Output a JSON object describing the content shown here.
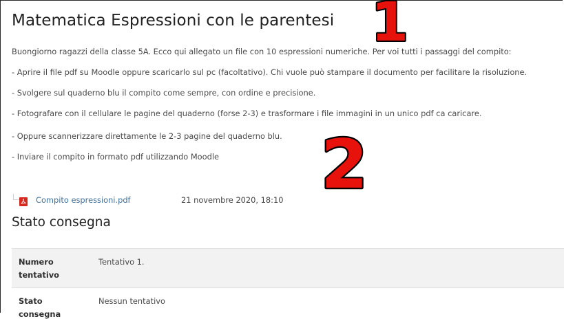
{
  "page": {
    "title": "Matematica Espressioni con le parentesi",
    "intro": "Buongiorno ragazzi della classe 5A. Ecco qui allegato un file con 10 espressioni numeriche. Per voi tutti i passaggi del compito:",
    "steps": [
      "- Aprire il file pdf su Moodle oppure scaricarlo sul pc (facoltativo). Chi vuole può stampare il documento per facilitare la risoluzione.",
      "- Svolgere sul quaderno blu il compito come sempre, con ordine e precisione.",
      "- Fotografare con il cellulare le pagine del quaderno (forse 2-3) e trasformare i file immagini in un unico pdf ca caricare.",
      "- Oppure scannerizzare direttamente le 2-3 pagine del quaderno blu.",
      "- Inviare il compito in formato pdf utilizzando Moodle"
    ]
  },
  "attachment": {
    "icon": "pdf-file-icon",
    "name": "Compito espressioni.pdf",
    "date": "21 novembre 2020, 18:10"
  },
  "submission": {
    "title": "Stato consegna",
    "rows": [
      {
        "label": "Numero tentativo",
        "value": "Tentativo 1."
      },
      {
        "label": "Stato consegna",
        "value": "Nessun tentativo"
      }
    ]
  },
  "annotations": {
    "marker_1": "1",
    "marker_2": "2",
    "marker_color": "#e8120c"
  }
}
